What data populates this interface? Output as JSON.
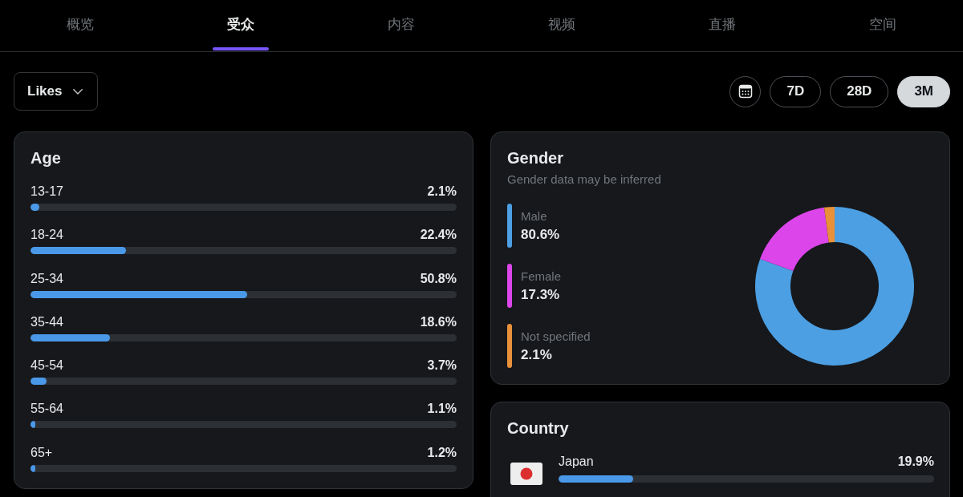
{
  "tabs": [
    {
      "label": "概览",
      "selected": false
    },
    {
      "label": "受众",
      "selected": true
    },
    {
      "label": "内容",
      "selected": false
    },
    {
      "label": "视频",
      "selected": false
    },
    {
      "label": "直播",
      "selected": false
    },
    {
      "label": "空间",
      "selected": false
    }
  ],
  "metric_dropdown": {
    "value": "Likes"
  },
  "date_range": [
    {
      "label": "7D",
      "selected": false
    },
    {
      "label": "28D",
      "selected": false
    },
    {
      "label": "3M",
      "selected": true
    }
  ],
  "age": {
    "title": "Age",
    "rows": [
      {
        "label": "13-17",
        "value": "2.1%",
        "level": 0.021
      },
      {
        "label": "18-24",
        "value": "22.4%",
        "level": 0.224
      },
      {
        "label": "25-34",
        "value": "50.8%",
        "level": 0.508
      },
      {
        "label": "35-44",
        "value": "18.6%",
        "level": 0.186
      },
      {
        "label": "45-54",
        "value": "3.7%",
        "level": 0.037
      },
      {
        "label": "55-64",
        "value": "1.1%",
        "level": 0.011
      },
      {
        "label": "65+",
        "value": "1.2%",
        "level": 0.012
      }
    ]
  },
  "gender": {
    "title": "Gender",
    "subtitle": "Gender data may be inferred",
    "legend": [
      {
        "label": "Male",
        "value": "80.6%",
        "color": "#4c9fe2"
      },
      {
        "label": "Female",
        "value": "17.3%",
        "color": "#dc45ea"
      },
      {
        "label": "Not specified",
        "value": "2.1%",
        "color": "#e8913a"
      }
    ],
    "chart_data": {
      "type": "donut",
      "values": [
        80.6,
        17.3,
        2.1
      ],
      "colors": [
        "#4c9fe2",
        "#dc45ea",
        "#e8913a"
      ]
    }
  },
  "country": {
    "title": "Country",
    "rows": [
      {
        "name": "Japan",
        "value": "19.9%",
        "level": 0.199
      }
    ]
  }
}
